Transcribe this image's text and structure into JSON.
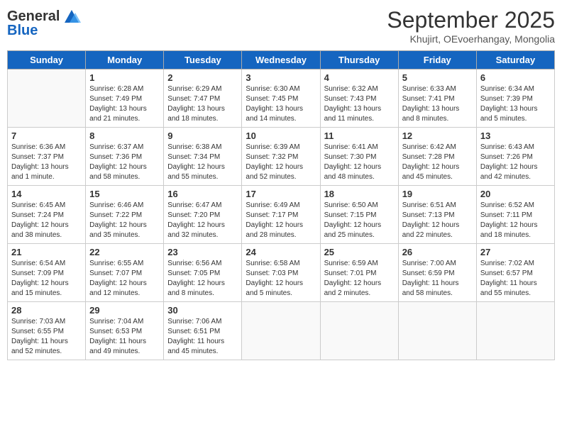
{
  "header": {
    "logo_general": "General",
    "logo_blue": "Blue",
    "month_title": "September 2025",
    "subtitle": "Khujirt, OEvoerhangay, Mongolia"
  },
  "days_of_week": [
    "Sunday",
    "Monday",
    "Tuesday",
    "Wednesday",
    "Thursday",
    "Friday",
    "Saturday"
  ],
  "weeks": [
    [
      {
        "day": "",
        "info": ""
      },
      {
        "day": "1",
        "info": "Sunrise: 6:28 AM\nSunset: 7:49 PM\nDaylight: 13 hours\nand 21 minutes."
      },
      {
        "day": "2",
        "info": "Sunrise: 6:29 AM\nSunset: 7:47 PM\nDaylight: 13 hours\nand 18 minutes."
      },
      {
        "day": "3",
        "info": "Sunrise: 6:30 AM\nSunset: 7:45 PM\nDaylight: 13 hours\nand 14 minutes."
      },
      {
        "day": "4",
        "info": "Sunrise: 6:32 AM\nSunset: 7:43 PM\nDaylight: 13 hours\nand 11 minutes."
      },
      {
        "day": "5",
        "info": "Sunrise: 6:33 AM\nSunset: 7:41 PM\nDaylight: 13 hours\nand 8 minutes."
      },
      {
        "day": "6",
        "info": "Sunrise: 6:34 AM\nSunset: 7:39 PM\nDaylight: 13 hours\nand 5 minutes."
      }
    ],
    [
      {
        "day": "7",
        "info": "Sunrise: 6:36 AM\nSunset: 7:37 PM\nDaylight: 13 hours\nand 1 minute."
      },
      {
        "day": "8",
        "info": "Sunrise: 6:37 AM\nSunset: 7:36 PM\nDaylight: 12 hours\nand 58 minutes."
      },
      {
        "day": "9",
        "info": "Sunrise: 6:38 AM\nSunset: 7:34 PM\nDaylight: 12 hours\nand 55 minutes."
      },
      {
        "day": "10",
        "info": "Sunrise: 6:39 AM\nSunset: 7:32 PM\nDaylight: 12 hours\nand 52 minutes."
      },
      {
        "day": "11",
        "info": "Sunrise: 6:41 AM\nSunset: 7:30 PM\nDaylight: 12 hours\nand 48 minutes."
      },
      {
        "day": "12",
        "info": "Sunrise: 6:42 AM\nSunset: 7:28 PM\nDaylight: 12 hours\nand 45 minutes."
      },
      {
        "day": "13",
        "info": "Sunrise: 6:43 AM\nSunset: 7:26 PM\nDaylight: 12 hours\nand 42 minutes."
      }
    ],
    [
      {
        "day": "14",
        "info": "Sunrise: 6:45 AM\nSunset: 7:24 PM\nDaylight: 12 hours\nand 38 minutes."
      },
      {
        "day": "15",
        "info": "Sunrise: 6:46 AM\nSunset: 7:22 PM\nDaylight: 12 hours\nand 35 minutes."
      },
      {
        "day": "16",
        "info": "Sunrise: 6:47 AM\nSunset: 7:20 PM\nDaylight: 12 hours\nand 32 minutes."
      },
      {
        "day": "17",
        "info": "Sunrise: 6:49 AM\nSunset: 7:17 PM\nDaylight: 12 hours\nand 28 minutes."
      },
      {
        "day": "18",
        "info": "Sunrise: 6:50 AM\nSunset: 7:15 PM\nDaylight: 12 hours\nand 25 minutes."
      },
      {
        "day": "19",
        "info": "Sunrise: 6:51 AM\nSunset: 7:13 PM\nDaylight: 12 hours\nand 22 minutes."
      },
      {
        "day": "20",
        "info": "Sunrise: 6:52 AM\nSunset: 7:11 PM\nDaylight: 12 hours\nand 18 minutes."
      }
    ],
    [
      {
        "day": "21",
        "info": "Sunrise: 6:54 AM\nSunset: 7:09 PM\nDaylight: 12 hours\nand 15 minutes."
      },
      {
        "day": "22",
        "info": "Sunrise: 6:55 AM\nSunset: 7:07 PM\nDaylight: 12 hours\nand 12 minutes."
      },
      {
        "day": "23",
        "info": "Sunrise: 6:56 AM\nSunset: 7:05 PM\nDaylight: 12 hours\nand 8 minutes."
      },
      {
        "day": "24",
        "info": "Sunrise: 6:58 AM\nSunset: 7:03 PM\nDaylight: 12 hours\nand 5 minutes."
      },
      {
        "day": "25",
        "info": "Sunrise: 6:59 AM\nSunset: 7:01 PM\nDaylight: 12 hours\nand 2 minutes."
      },
      {
        "day": "26",
        "info": "Sunrise: 7:00 AM\nSunset: 6:59 PM\nDaylight: 11 hours\nand 58 minutes."
      },
      {
        "day": "27",
        "info": "Sunrise: 7:02 AM\nSunset: 6:57 PM\nDaylight: 11 hours\nand 55 minutes."
      }
    ],
    [
      {
        "day": "28",
        "info": "Sunrise: 7:03 AM\nSunset: 6:55 PM\nDaylight: 11 hours\nand 52 minutes."
      },
      {
        "day": "29",
        "info": "Sunrise: 7:04 AM\nSunset: 6:53 PM\nDaylight: 11 hours\nand 49 minutes."
      },
      {
        "day": "30",
        "info": "Sunrise: 7:06 AM\nSunset: 6:51 PM\nDaylight: 11 hours\nand 45 minutes."
      },
      {
        "day": "",
        "info": ""
      },
      {
        "day": "",
        "info": ""
      },
      {
        "day": "",
        "info": ""
      },
      {
        "day": "",
        "info": ""
      }
    ]
  ]
}
